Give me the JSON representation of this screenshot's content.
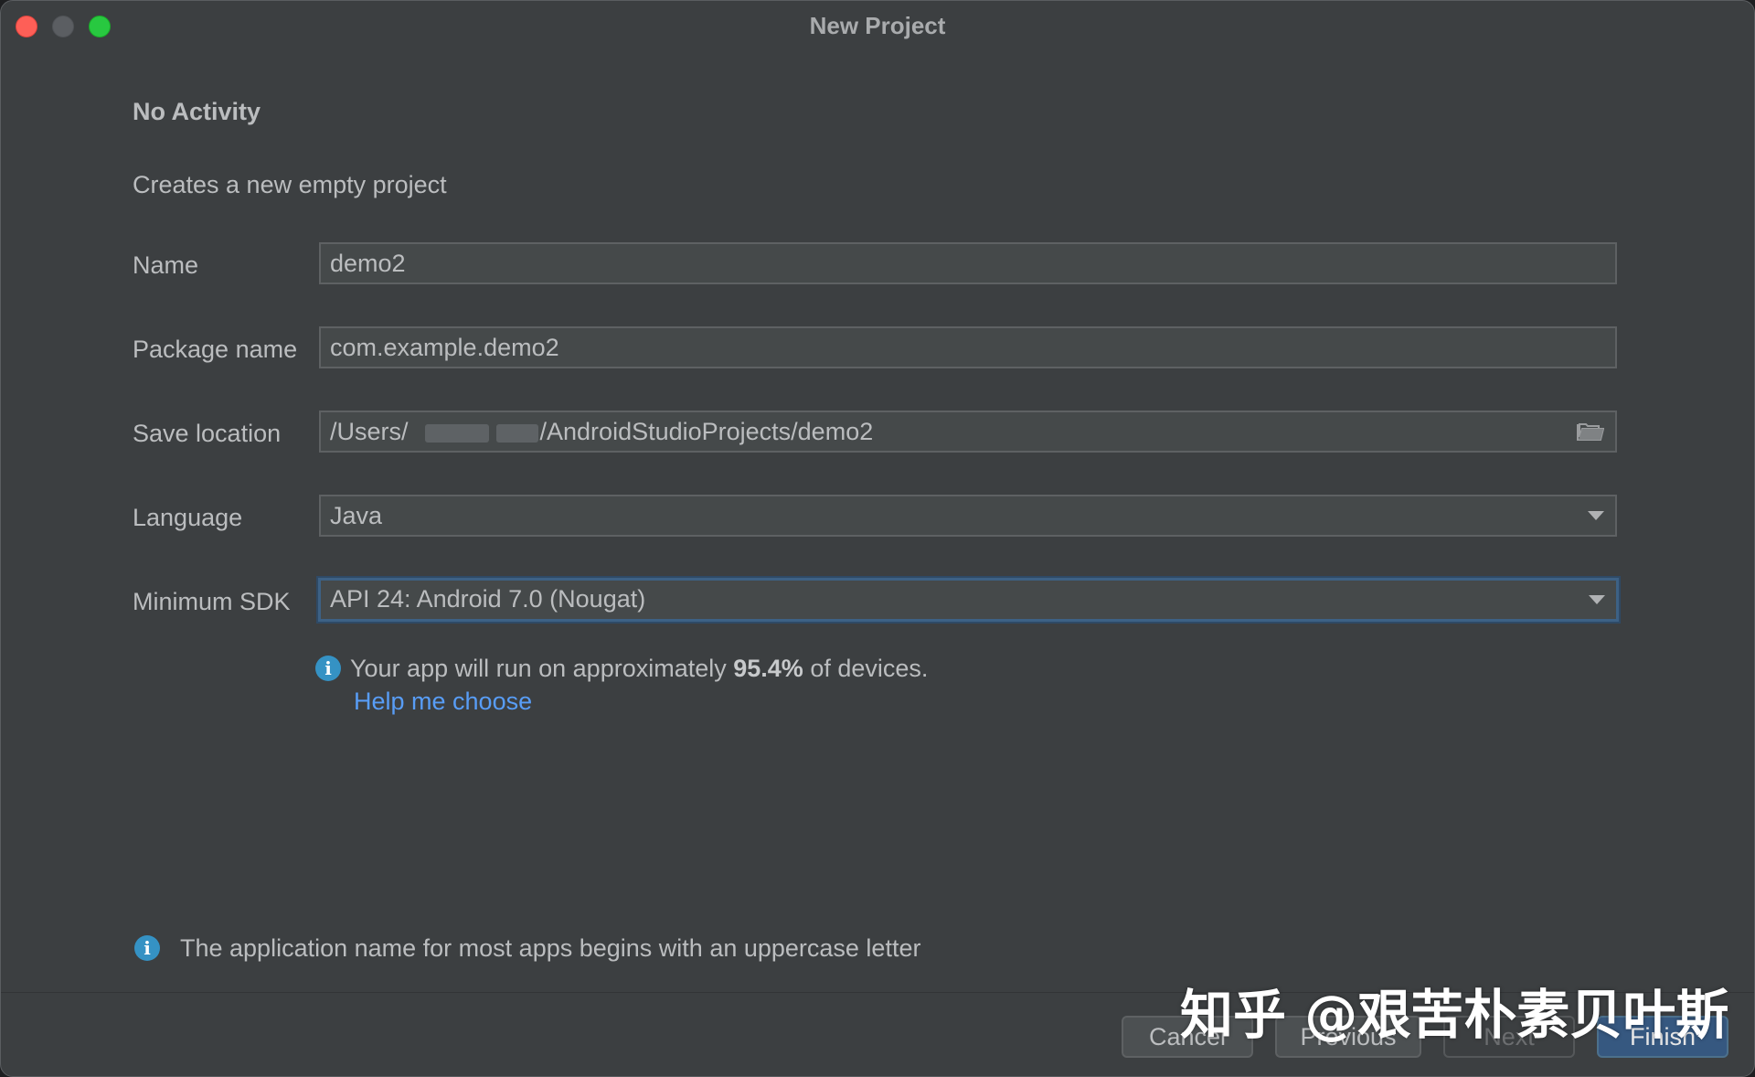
{
  "window": {
    "title": "New Project"
  },
  "page": {
    "heading": "No Activity",
    "subtitle": "Creates a new empty project"
  },
  "form": {
    "name": {
      "label": "Name",
      "value": "demo2"
    },
    "package_name": {
      "label": "Package name",
      "value": "com.example.demo2"
    },
    "save_location": {
      "label": "Save location",
      "value_prefix": "/Users/",
      "value_suffix": "/AndroidStudioProjects/demo2",
      "icon": "folder-icon"
    },
    "language": {
      "label": "Language",
      "value": "Java"
    },
    "minimum_sdk": {
      "label": "Minimum SDK",
      "value": "API 24: Android 7.0 (Nougat)"
    }
  },
  "sdk_info": {
    "text_before": "Your app will run on approximately ",
    "percent": "95.4%",
    "text_after": " of devices.",
    "help_link": "Help me choose"
  },
  "hint": {
    "text": "The application name for most apps begins with an uppercase letter"
  },
  "buttons": {
    "cancel": "Cancel",
    "previous": "Previous",
    "next": "Next",
    "finish": "Finish"
  },
  "watermark": "知乎 @艰苦朴素贝叶斯",
  "colors": {
    "background": "#3c3f41",
    "link": "#589df6",
    "info": "#3592c4",
    "primary_button": "#365880"
  }
}
